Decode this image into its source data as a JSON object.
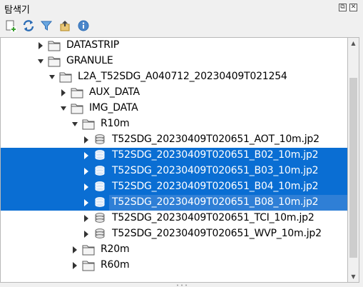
{
  "panel": {
    "title": "탐색기",
    "float_glyph": "⧉",
    "close_glyph": "✕"
  },
  "toolbar": {
    "items": [
      {
        "icon": "add-layer-icon"
      },
      {
        "icon": "refresh-icon"
      },
      {
        "icon": "filter-icon"
      },
      {
        "icon": "collapse-all-icon"
      },
      {
        "icon": "info-icon"
      }
    ],
    "colors": {
      "refresh": "#2d6db5",
      "filter": "#3a7fc9",
      "info": "#2d6db5"
    }
  },
  "tree": {
    "selection_color": "#0a6ed3",
    "items": [
      {
        "label": "DATASTRIP",
        "type": "folder",
        "expanded": false,
        "depth": 0,
        "selected": false
      },
      {
        "label": "GRANULE",
        "type": "folder",
        "expanded": true,
        "depth": 0,
        "selected": false
      },
      {
        "label": "L2A_T52SDG_A040712_20230409T021254",
        "type": "folder",
        "expanded": true,
        "depth": 1,
        "selected": false
      },
      {
        "label": "AUX_DATA",
        "type": "folder",
        "expanded": false,
        "depth": 2,
        "selected": false
      },
      {
        "label": "IMG_DATA",
        "type": "folder",
        "expanded": true,
        "depth": 2,
        "selected": false
      },
      {
        "label": "R10m",
        "type": "folder",
        "expanded": true,
        "depth": 3,
        "selected": false
      },
      {
        "label": "T52SDG_20230409T020651_AOT_10m.jp2",
        "type": "raster",
        "expanded": false,
        "depth": 4,
        "selected": false
      },
      {
        "label": "T52SDG_20230409T020651_B02_10m.jp2",
        "type": "raster",
        "expanded": false,
        "depth": 4,
        "selected": true
      },
      {
        "label": "T52SDG_20230409T020651_B03_10m.jp2",
        "type": "raster",
        "expanded": false,
        "depth": 4,
        "selected": true
      },
      {
        "label": "T52SDG_20230409T020651_B04_10m.jp2",
        "type": "raster",
        "expanded": false,
        "depth": 4,
        "selected": true
      },
      {
        "label": "T52SDG_20230409T020651_B08_10m.jp2",
        "type": "raster",
        "expanded": false,
        "depth": 4,
        "selected": true,
        "current": true
      },
      {
        "label": "T52SDG_20230409T020651_TCI_10m.jp2",
        "type": "raster",
        "expanded": false,
        "depth": 4,
        "selected": false
      },
      {
        "label": "T52SDG_20230409T020651_WVP_10m.jp2",
        "type": "raster",
        "expanded": false,
        "depth": 4,
        "selected": false
      },
      {
        "label": "R20m",
        "type": "folder",
        "expanded": false,
        "depth": 3,
        "selected": false
      },
      {
        "label": "R60m",
        "type": "folder",
        "expanded": false,
        "depth": 3,
        "selected": false
      }
    ]
  }
}
